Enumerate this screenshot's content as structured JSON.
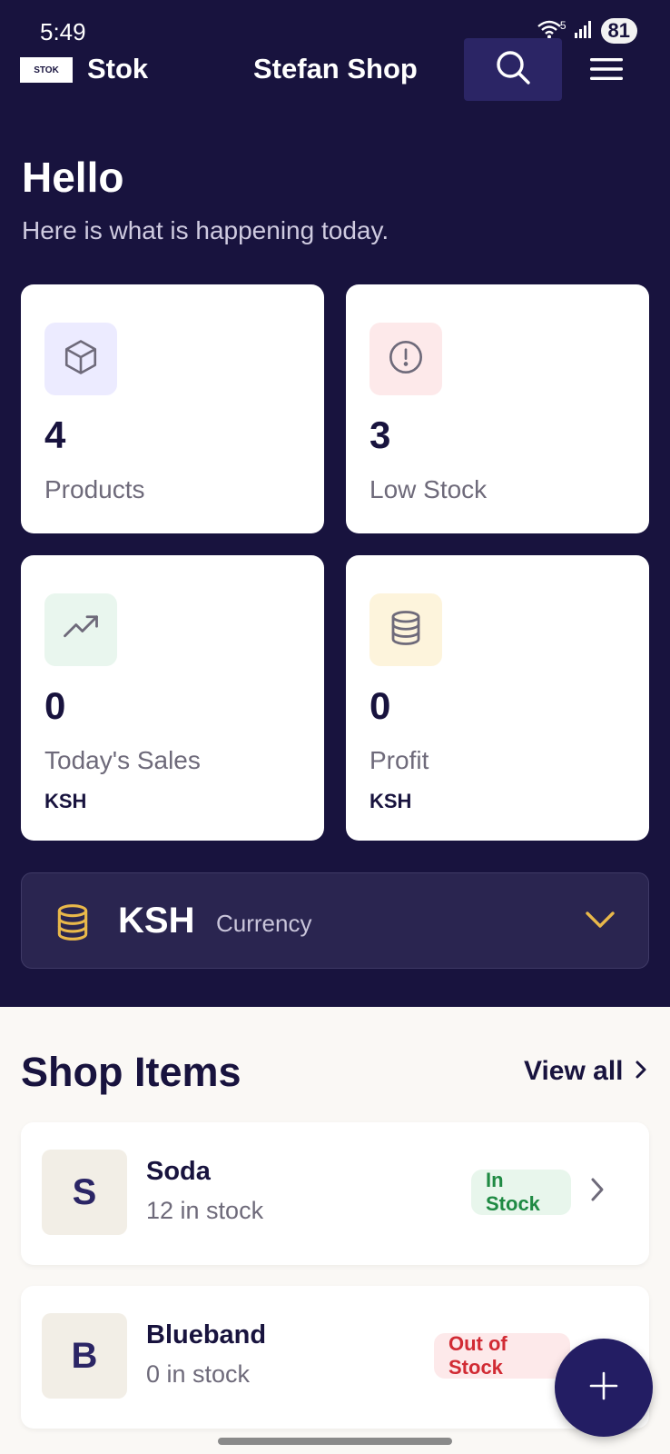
{
  "status_bar": {
    "time": "5:49",
    "network": "5",
    "battery": "81"
  },
  "header": {
    "logo_text": "STOK",
    "app_name": "Stok",
    "shop_name": "Stefan Shop"
  },
  "greeting": {
    "title": "Hello",
    "subtitle": "Here is what is happening today."
  },
  "stats": [
    {
      "value": "4",
      "label": "Products",
      "icon": "cube-icon",
      "tint": "#ecebff"
    },
    {
      "value": "3",
      "label": "Low Stock",
      "icon": "alert-circle-icon",
      "tint": "#fde9ea"
    },
    {
      "value": "0",
      "label": "Today's Sales",
      "unit": "KSH",
      "icon": "trending-up-icon",
      "tint": "#e9f6ee"
    },
    {
      "value": "0",
      "label": "Profit",
      "unit": "KSH",
      "icon": "database-icon",
      "tint": "#fdf4dc"
    }
  ],
  "currency": {
    "code": "KSH",
    "label": "Currency"
  },
  "shop_items": {
    "title": "Shop Items",
    "view_all": "View all",
    "items": [
      {
        "initial": "S",
        "name": "Soda",
        "qty": "12 in stock",
        "status": "In Stock"
      },
      {
        "initial": "B",
        "name": "Blueband",
        "qty": "0 in stock",
        "status": "Out of Stock"
      }
    ]
  },
  "colors": {
    "background_dark": "#18133e",
    "accent_gold": "#e9b84a",
    "in_stock": "#1f8a43",
    "out_of_stock": "#d12b34"
  }
}
